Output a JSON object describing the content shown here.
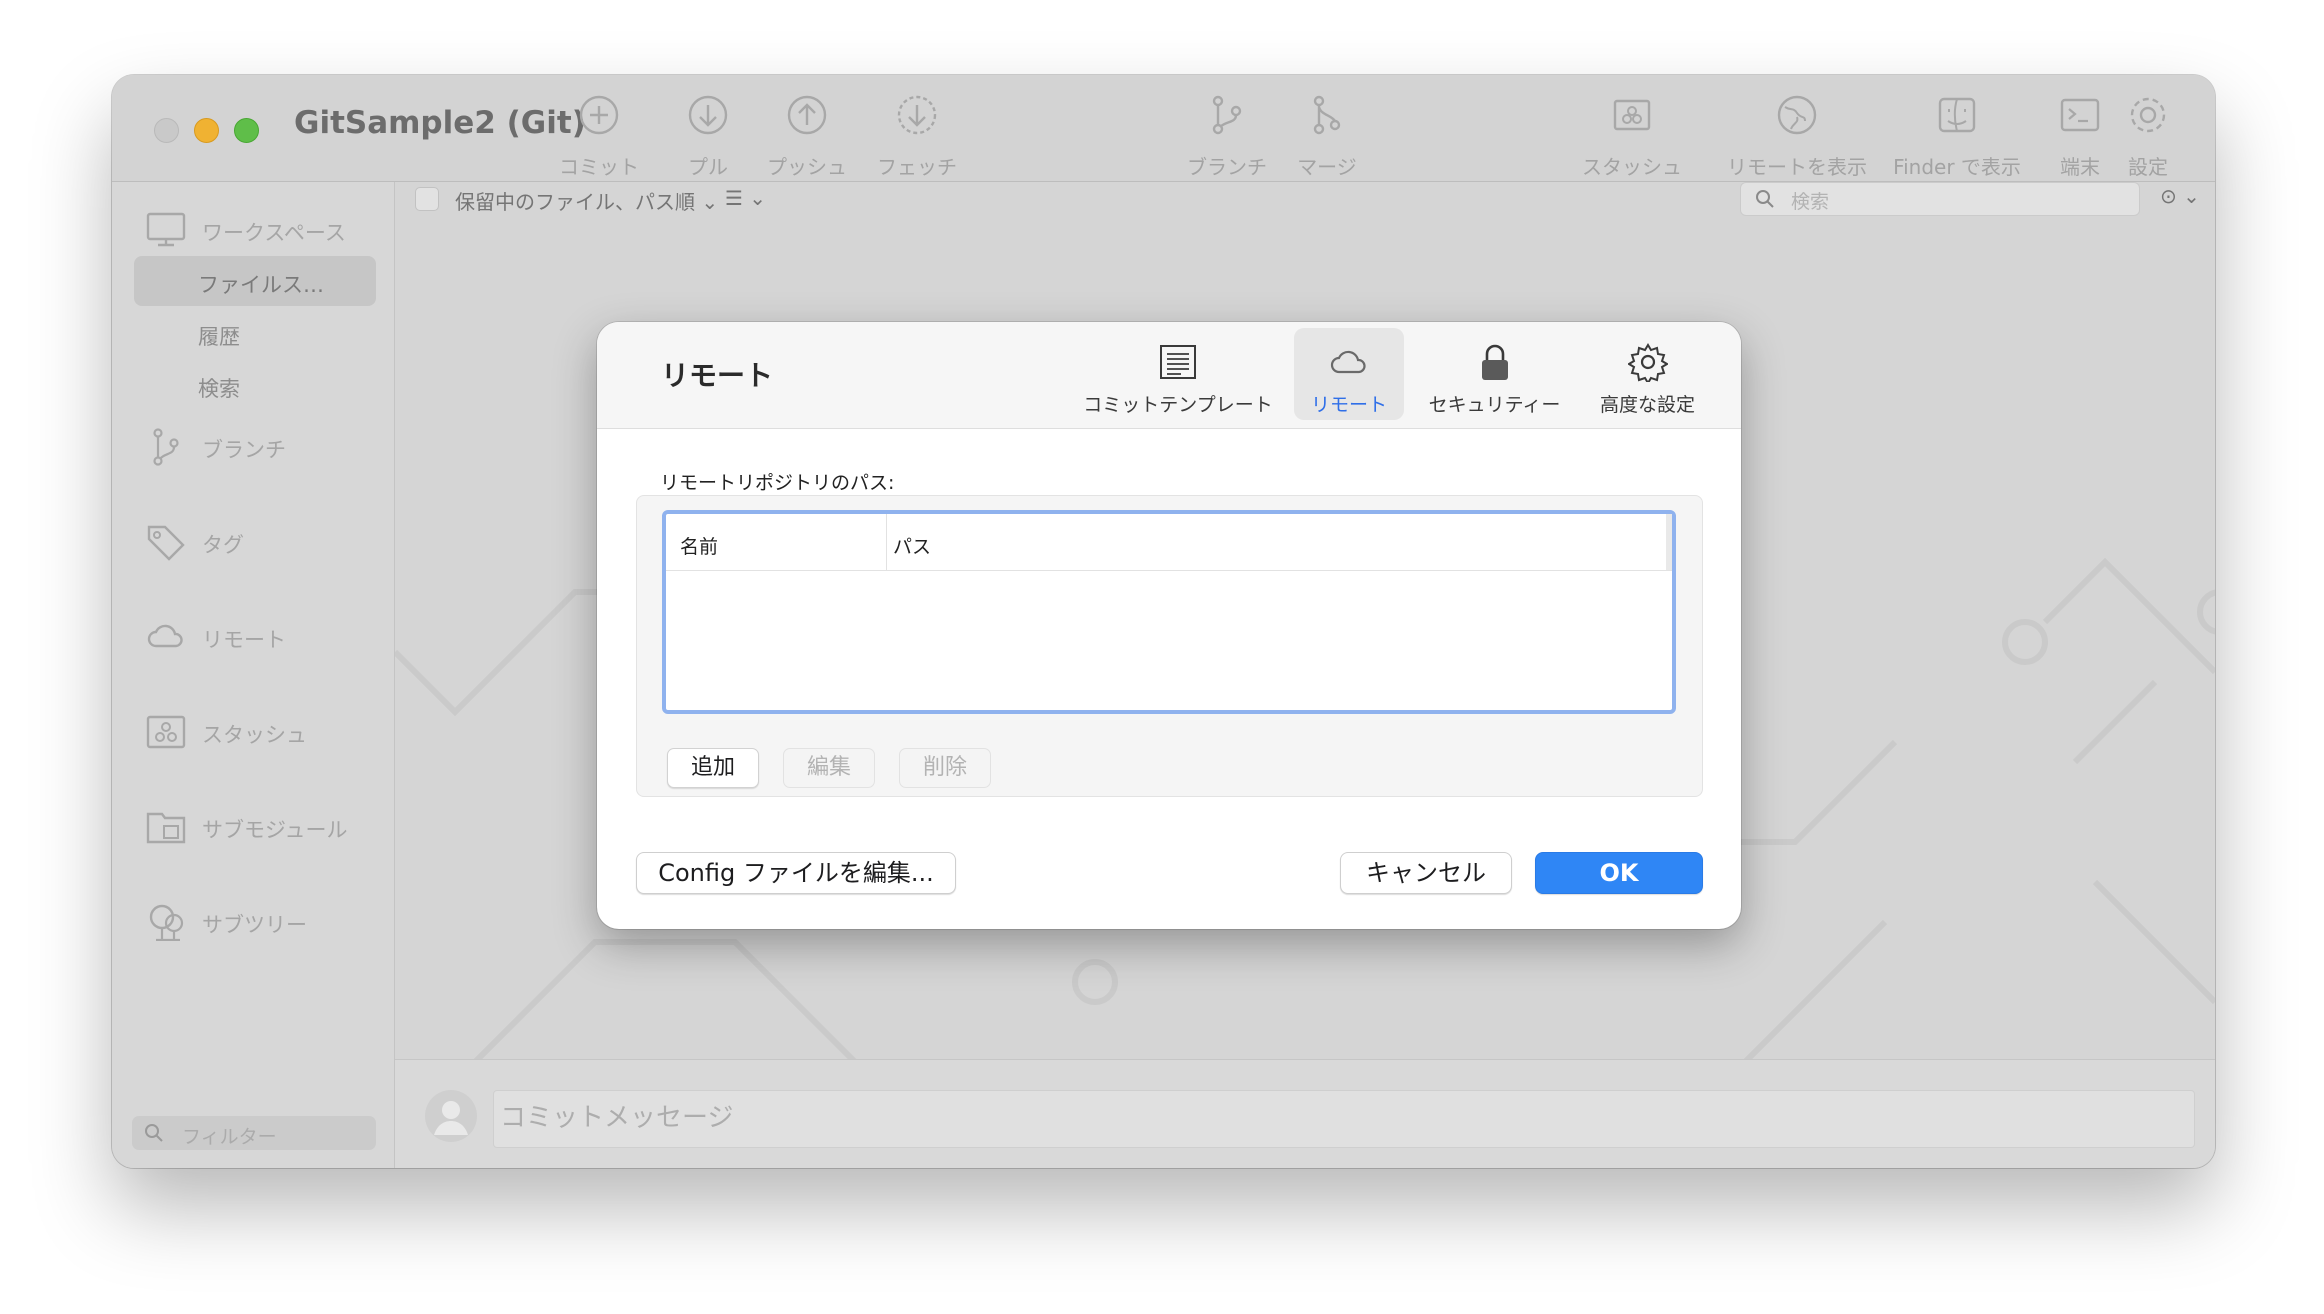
{
  "window": {
    "title": "GitSample2 (Git)"
  },
  "toolbar": {
    "commit": "コミット",
    "pull": "プル",
    "push": "プッシュ",
    "fetch": "フェッチ",
    "branch": "ブランチ",
    "merge": "マージ",
    "stash": "スタッシュ",
    "show_remote": "リモートを表示",
    "show_finder": "Finder で表示",
    "terminal": "端末",
    "settings": "設定"
  },
  "subtoolbar": {
    "sort_label": "保留中のファイル、パス順",
    "search_placeholder": "検索"
  },
  "sidebar": {
    "workspace": "ワークスペース",
    "workspace_items": [
      "ファイルス…",
      "履歴",
      "検索"
    ],
    "branches": "ブランチ",
    "tags": "タグ",
    "remotes": "リモート",
    "stashes": "スタッシュ",
    "submodules": "サブモジュール",
    "subtrees": "サブツリー",
    "filter_placeholder": "フィルター"
  },
  "commit_bar": {
    "placeholder": "コミットメッセージ"
  },
  "dialog": {
    "title": "リモート",
    "tabs": [
      {
        "label": "コミットテンプレート",
        "icon": "document-icon"
      },
      {
        "label": "リモート",
        "icon": "cloud-icon",
        "active": true
      },
      {
        "label": "セキュリティー",
        "icon": "lock-icon"
      },
      {
        "label": "高度な設定",
        "icon": "gear-icon"
      }
    ],
    "section_label": "リモートリポジトリのパス:",
    "table": {
      "columns": [
        "名前",
        "パス"
      ],
      "rows": []
    },
    "add_button": "追加",
    "edit_button": "編集",
    "delete_button": "削除",
    "config_button": "Config ファイルを編集...",
    "cancel_button": "キャンセル",
    "ok_button": "OK"
  },
  "colors": {
    "accent": "#2f86f5",
    "selected_tab": "#2f6fe8"
  }
}
